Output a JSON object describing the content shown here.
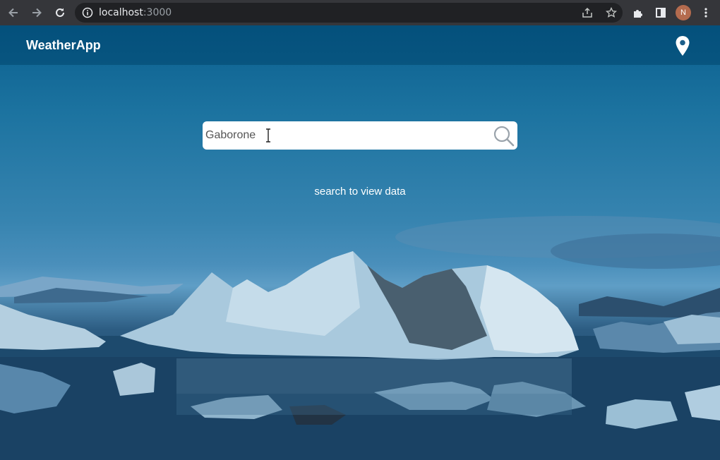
{
  "browser": {
    "url_host": "localhost",
    "url_port": ":3000",
    "profile_initial": "N",
    "icons": [
      "back-icon",
      "forward-icon",
      "reload-icon",
      "info-icon",
      "share-icon",
      "star-icon",
      "extensions-icon",
      "sidepanel-icon",
      "menu-icon"
    ]
  },
  "app": {
    "brand": "WeatherApp",
    "location_icon": "map-pin-icon"
  },
  "search": {
    "value": "Gaborone",
    "icon": "search-icon"
  },
  "hint": "search to view data",
  "colors": {
    "chrome_bg": "#35363a",
    "omnibox_bg": "#202124",
    "appbar": "#0f5a82",
    "text": "#ffffff"
  }
}
